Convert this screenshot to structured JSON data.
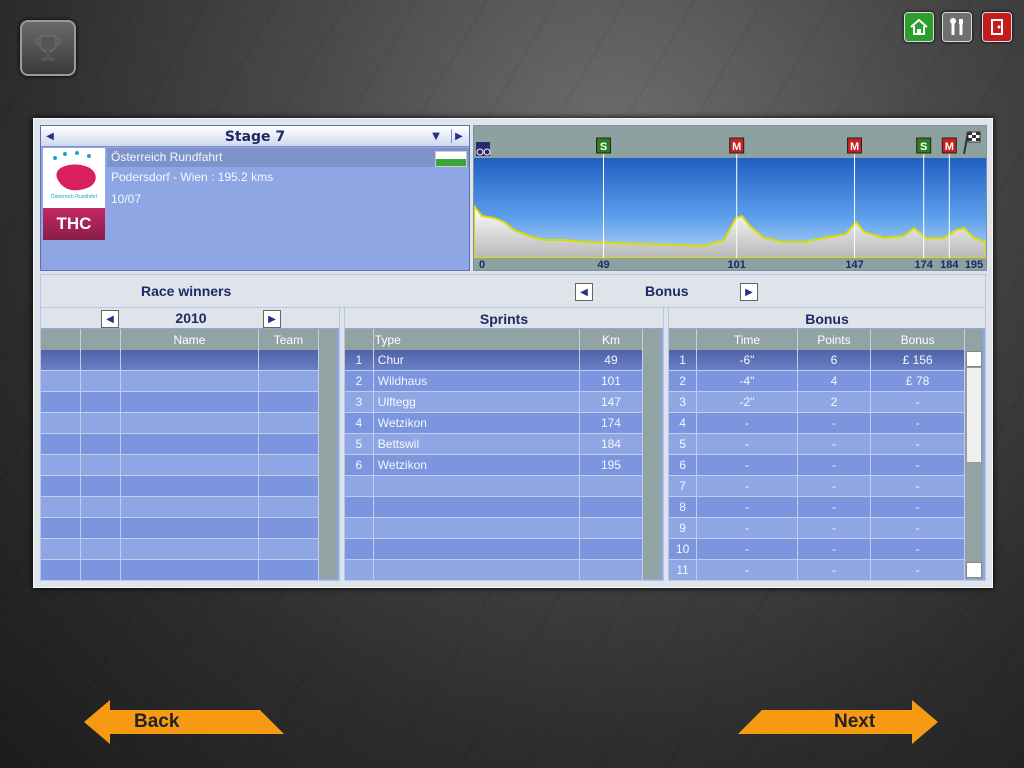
{
  "top_buttons": {
    "home_color": "#2b9e2b",
    "tools_color": "#777777",
    "exit_color": "#c41c1c"
  },
  "stage": {
    "title": "Stage 7",
    "logo_text": "THC",
    "logo_caption": "Österreich Rundfahrt",
    "race_name": "Österreich Rundfahrt",
    "route": "Podersdorf - Wien : 195.2 kms",
    "date": "10/07"
  },
  "profile": {
    "markers": [
      {
        "type": "S",
        "km": 49,
        "color": "#2f7d1f"
      },
      {
        "type": "M",
        "km": 101,
        "color": "#c62222"
      },
      {
        "type": "M",
        "km": 147,
        "color": "#c62222"
      },
      {
        "type": "S",
        "km": 174,
        "color": "#2f7d1f"
      },
      {
        "type": "M",
        "km": 184,
        "color": "#c62222"
      }
    ],
    "km_labels": [
      "0",
      "49",
      "101",
      "147",
      "174",
      "184",
      "195"
    ]
  },
  "winners": {
    "title": "Race winners",
    "year": "2010",
    "col_name": "Name",
    "col_team": "Team"
  },
  "bonus_selector": {
    "label": "Bonus"
  },
  "sprints": {
    "title": "Sprints",
    "col_type": "Type",
    "col_km": "Km",
    "rows": [
      {
        "n": "1",
        "type": "Chur",
        "km": "49"
      },
      {
        "n": "2",
        "type": "Wildhaus",
        "km": "101"
      },
      {
        "n": "3",
        "type": "Ulftegg",
        "km": "147"
      },
      {
        "n": "4",
        "type": "Wetzikon",
        "km": "174"
      },
      {
        "n": "5",
        "type": "Bettswil",
        "km": "184"
      },
      {
        "n": "6",
        "type": "Wetzikon",
        "km": "195"
      }
    ]
  },
  "bonus": {
    "title": "Bonus",
    "col_time": "Time",
    "col_points": "Points",
    "col_bonus": "Bonus",
    "rows": [
      {
        "n": "1",
        "time": "-6\"",
        "points": "6",
        "bonus": "£ 156"
      },
      {
        "n": "2",
        "time": "-4\"",
        "points": "4",
        "bonus": "£ 78"
      },
      {
        "n": "3",
        "time": "-2\"",
        "points": "2",
        "bonus": "-"
      },
      {
        "n": "4",
        "time": "-",
        "points": "-",
        "bonus": "-"
      },
      {
        "n": "5",
        "time": "-",
        "points": "-",
        "bonus": "-"
      },
      {
        "n": "6",
        "time": "-",
        "points": "-",
        "bonus": "-"
      },
      {
        "n": "7",
        "time": "-",
        "points": "-",
        "bonus": "-"
      },
      {
        "n": "8",
        "time": "-",
        "points": "-",
        "bonus": "-"
      },
      {
        "n": "9",
        "time": "-",
        "points": "-",
        "bonus": "-"
      },
      {
        "n": "10",
        "time": "-",
        "points": "-",
        "bonus": "-"
      },
      {
        "n": "11",
        "time": "-",
        "points": "-",
        "bonus": "-"
      }
    ]
  },
  "nav": {
    "back": "Back",
    "next": "Next",
    "arrow_color": "#f59a12"
  }
}
